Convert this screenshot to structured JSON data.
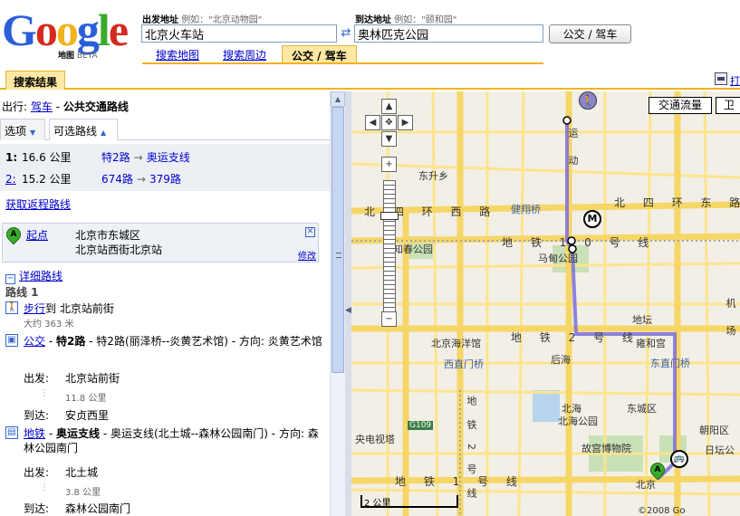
{
  "logo": {
    "text": "Google",
    "sub": "地图",
    "beta": "BETA"
  },
  "search": {
    "from_label": "出发地址",
    "from_hint": "例如：\"北京动物园\"",
    "from_value": "北京火车站",
    "to_label": "到达地址",
    "to_hint": "例如：\"颐和园\"",
    "to_value": "奥林匹克公园",
    "route_button": "公交 / 驾车"
  },
  "top_tabs": {
    "search_map": "搜索地图",
    "search_nearby": "搜索周边",
    "transit": "公交 / 驾车"
  },
  "results_tab": "搜索结果",
  "print_label": "打",
  "panel": {
    "trip_prefix": "出行:",
    "drive_link": "驾车",
    "trip_sep": " - ",
    "trip_title": "公共交通路线",
    "options_tab": "选项",
    "alt_routes_tab": "可选路线",
    "routes": [
      {
        "num": "1:",
        "dist": "16.6 公里",
        "from": "特2路",
        "to": "奥运支线",
        "selected": true
      },
      {
        "num": "2:",
        "dist": "15.2 公里",
        "from": "674路",
        "to": "379路",
        "selected": false
      }
    ],
    "reverse_link": "获取返程路线",
    "start": {
      "marker": "A",
      "label": "起点",
      "addr1": "北京市东城区",
      "addr2": "北京站西街北京站",
      "edit": "修改",
      "close": "✕"
    },
    "detail_toggle": "−",
    "detail_link": "详细路线",
    "route_name": "路线 1",
    "steps": [
      {
        "type": "walk",
        "link": "步行",
        "rest": "到 北京站前街",
        "sub": "大约 363 米"
      },
      {
        "type": "bus",
        "link": "公交",
        "bold": "特2路",
        "rest": " - 特2路(丽泽桥--炎黄艺术馆) - 方向:  炎黄艺术馆",
        "depart_label": "出发:",
        "depart": "北京站前街",
        "dist": "11.8 公里",
        "arrive_label": "到达:",
        "arrive": "安贞西里"
      },
      {
        "type": "subway",
        "link": "地铁",
        "bold": "奥运支线",
        "rest": " - 奥运支线(北土城--森林公园南门) - 方向:  森林公园南门",
        "depart_label": "出发:",
        "depart": "北土城",
        "dist": "3.8 公里",
        "arrive_label": "到达:",
        "arrive": "森林公园南门"
      }
    ]
  },
  "map": {
    "traffic_button": "交通流量",
    "sat_button": "卫",
    "scale_label": "2 公里",
    "labels": {
      "dongsheng": "东升乡",
      "north_4th_ring": "北 四 环 东 路",
      "jianxiang": "健翔桥",
      "north_4th_ring_w": "北 四 环 西 路",
      "zhichun": "知春公园",
      "line1": "地 铁 1 0 号 线",
      "madian": "马甸公园",
      "line2_top": "地 铁 2 号 线",
      "beijing_haiyang": "北京海洋馆",
      "xizhimen": "西直门桥",
      "houhai": "后海",
      "ditan": "地坛",
      "yonghegong": "雍和宫",
      "dongzhimen": "东直门桥",
      "beihai": "北海",
      "beihai_park": "北海公园",
      "dongcheng": "东城区",
      "chaoyang": "朝阳区",
      "ritan": "日坛公",
      "gugong": "故宫博物院",
      "cctv": "央电视塔",
      "g109": "G109",
      "line1_bottom": "地 铁 1 号 线",
      "line5": "地 铁 5 号 线",
      "line_v": "地 铁 2 号 线",
      "yundong": "运 动",
      "airport_rd": "机 场",
      "beijing": "北京",
      "copyright": "©2008 Go"
    },
    "markers": {
      "walk": "walk-icon",
      "metro": "M",
      "bus": "bus-icon",
      "start": "A"
    },
    "route_color": "#7b6fdc",
    "road_color": "#f6d667"
  }
}
